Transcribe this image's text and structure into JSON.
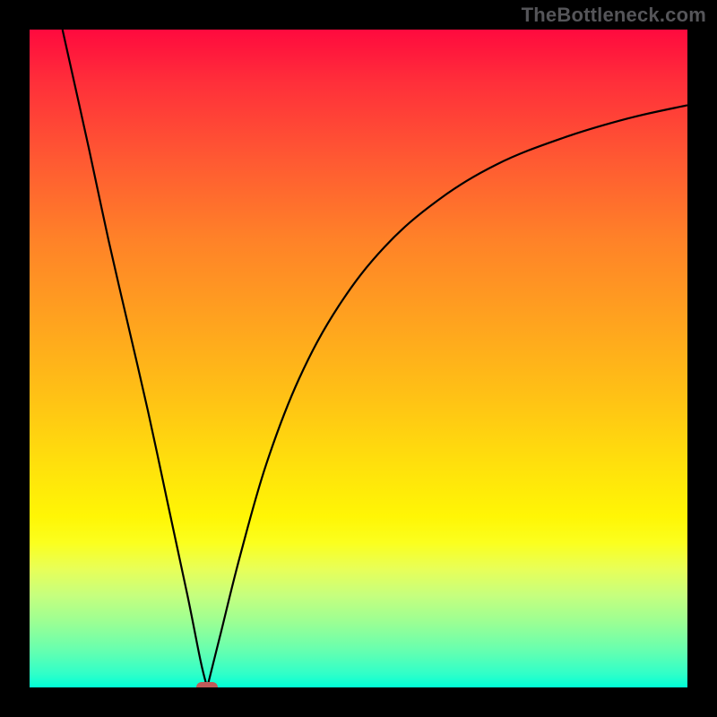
{
  "watermark": "TheBottleneck.com",
  "colors": {
    "marker": "#c05a59",
    "curve": "#000000"
  },
  "chart_data": {
    "type": "line",
    "title": "",
    "xlabel": "",
    "ylabel": "",
    "xlim": [
      0,
      100
    ],
    "ylim": [
      0,
      100
    ],
    "grid": false,
    "legend": false,
    "minimum_x": 27,
    "series": [
      {
        "name": "left-branch",
        "x": [
          5,
          9,
          12,
          15,
          18,
          21,
          24,
          26,
          27
        ],
        "y": [
          100,
          82,
          68,
          55,
          42,
          28,
          14,
          4,
          0
        ]
      },
      {
        "name": "right-branch",
        "x": [
          27,
          29,
          32,
          36,
          41,
          47,
          54,
          62,
          71,
          81,
          91,
          100
        ],
        "y": [
          0,
          8,
          20,
          34,
          47,
          58,
          67,
          74,
          79.5,
          83.5,
          86.5,
          88.5
        ]
      }
    ],
    "marker": {
      "x": 27,
      "y": 0
    }
  }
}
